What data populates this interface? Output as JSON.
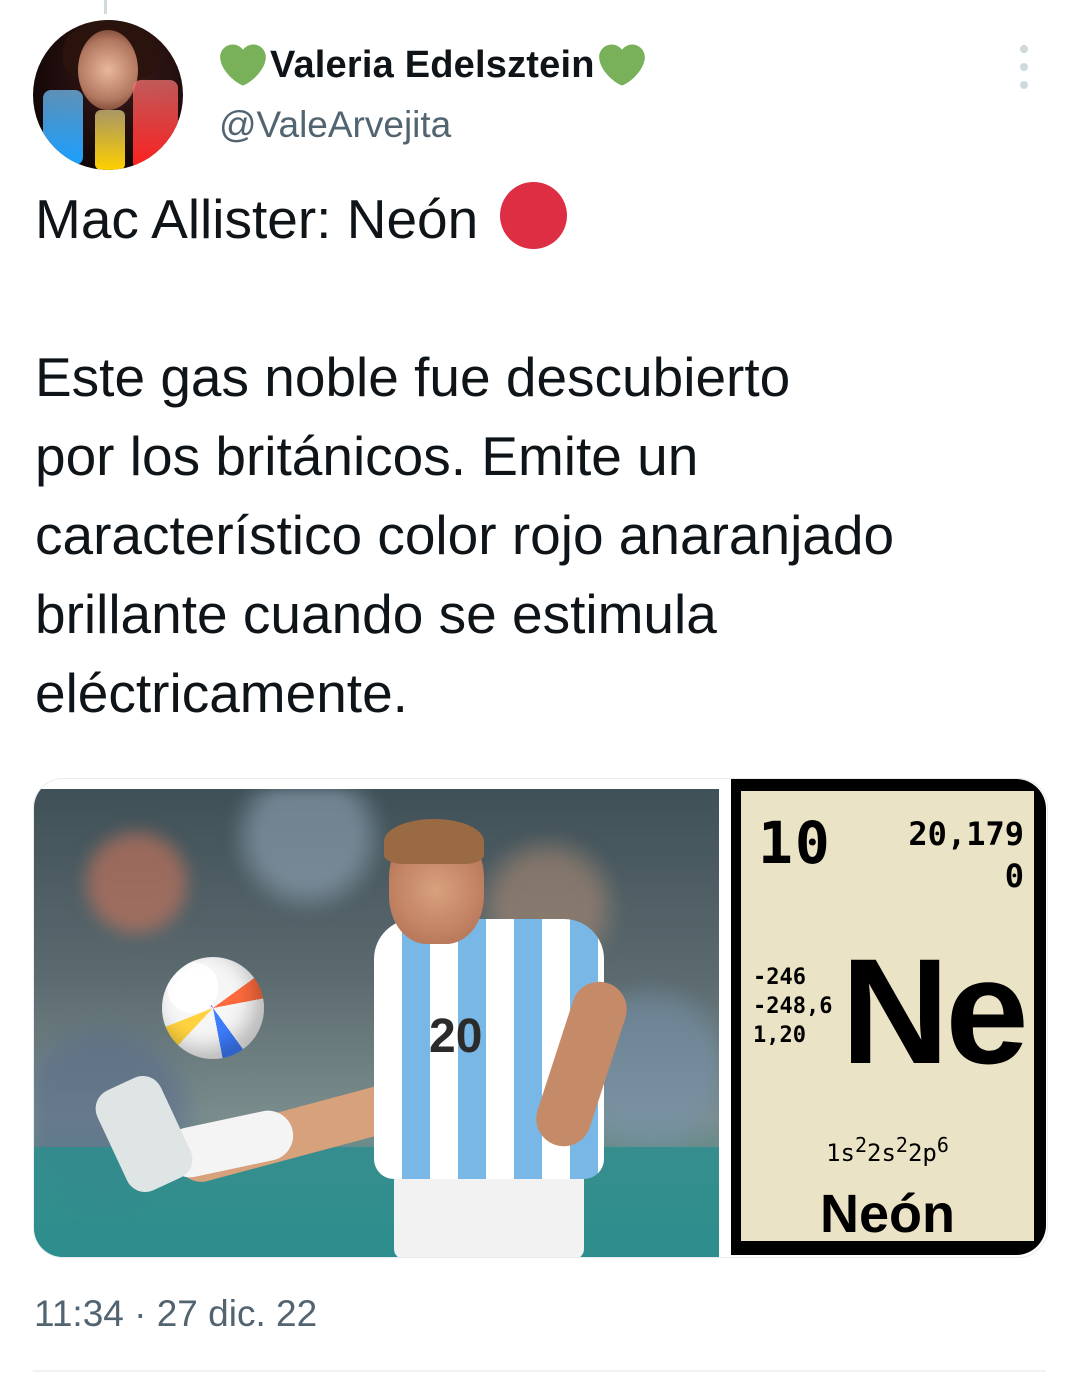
{
  "author": {
    "name": "Valeria Edelsztein",
    "handle": "@ValeArvejita",
    "name_emoji": "green-heart"
  },
  "tweet": {
    "heading": "Mac Allister: Neón",
    "heading_emoji": "red-circle",
    "body": [
      "Este gas noble fue descubierto",
      "por los británicos. Emite un",
      "característico color rojo anaranjado",
      "brillante cuando se estimula",
      "eléctricamente."
    ],
    "timestamp": "11:34 · 27 dic. 22"
  },
  "element_card": {
    "atomic_number": "10",
    "atomic_mass": "20,179",
    "oxidation": "0",
    "temps": [
      "-246",
      "-248,6",
      "1,20"
    ],
    "symbol": "Ne",
    "config_parts": [
      "1s",
      "2",
      "2s",
      "2",
      "2p",
      "6"
    ],
    "name": "Neón"
  },
  "photo": {
    "jersey_number": "20"
  },
  "colors": {
    "green_heart": "#78b159",
    "red_circle": "#dd2e44",
    "secondary_text": "#536471"
  }
}
